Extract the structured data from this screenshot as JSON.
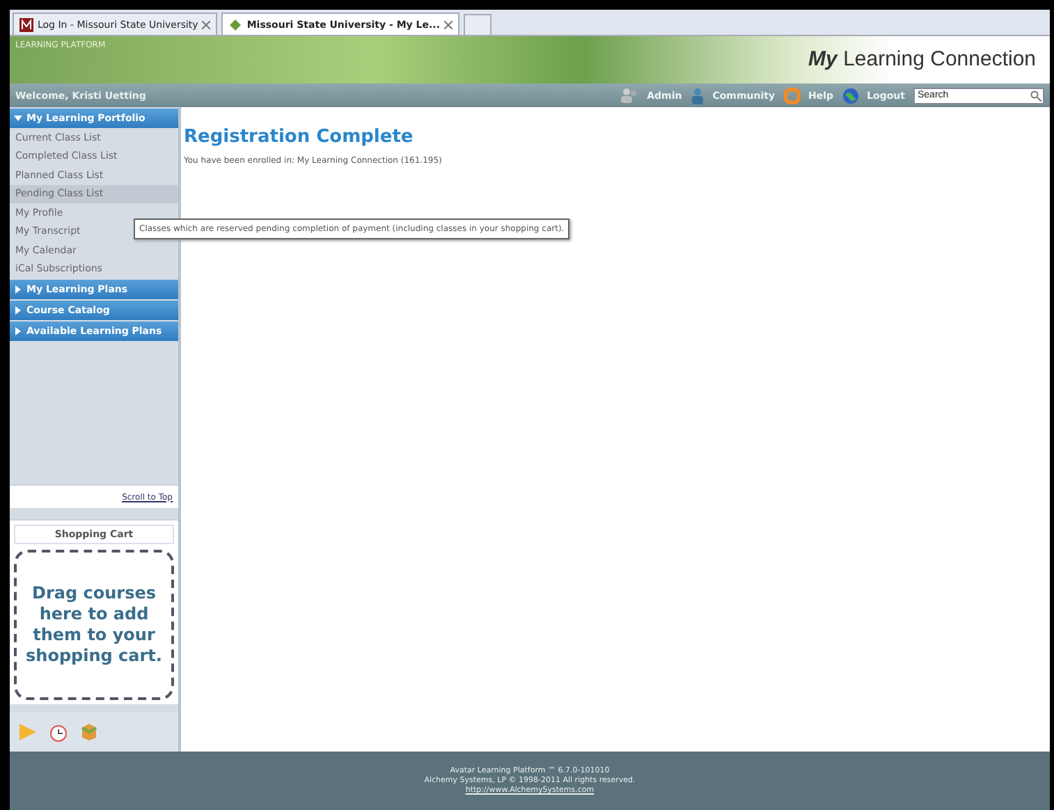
{
  "browser_tabs": [
    {
      "label": "Log In - Missouri State University",
      "selected": false
    },
    {
      "label": "Missouri State University - My Le...",
      "selected": true
    }
  ],
  "header": {
    "platform": "LEARNING PLATFORM",
    "title_bold": "My",
    "title": "Learning Connection"
  },
  "nav_bar": {
    "welcome": "Welcome, Kristi Uetting",
    "links": [
      {
        "label": "Admin",
        "kind": "admin"
      },
      {
        "label": "Community",
        "kind": "community"
      },
      {
        "label": "Help",
        "kind": "help"
      },
      {
        "label": "Logout",
        "kind": "logout"
      }
    ],
    "search": {
      "placeholder": "Search"
    }
  },
  "sidebar": {
    "sections": [
      {
        "label": "My Learning Portfolio",
        "expanded": true,
        "items": [
          {
            "label": "Current Class List",
            "selected": false
          },
          {
            "label": "Completed Class List",
            "selected": false
          },
          {
            "label": "Planned Class List",
            "selected": false
          },
          {
            "label": "Pending Class List",
            "selected": true
          },
          {
            "label": "My Profile",
            "selected": false
          },
          {
            "label": "My Transcript",
            "selected": false
          },
          {
            "label": "My Calendar",
            "selected": false
          },
          {
            "label": "iCal Subscriptions",
            "selected": false
          }
        ]
      },
      {
        "label": "My Learning Plans",
        "expanded": false
      },
      {
        "label": "Course Catalog",
        "expanded": false
      },
      {
        "label": "Available Learning Plans",
        "expanded": false
      }
    ],
    "scroll_link": "Scroll to Top",
    "cart": {
      "title": "Shopping Cart",
      "message": "Drag courses here to add them to your shopping cart."
    }
  },
  "main": {
    "heading": "Registration Complete",
    "message": "You have been enrolled in: My Learning Connection (161.195)"
  },
  "tooltip": "Classes which are reserved pending completion of payment (including classes in your shopping cart).",
  "footer": {
    "lines": [
      "Avatar Learning Platform ™ 6.7.0-101010",
      "Alchemy Systems, LP © 1998-2011 All rights reserved."
    ],
    "link": "http://www.AlchemySystems.com"
  }
}
